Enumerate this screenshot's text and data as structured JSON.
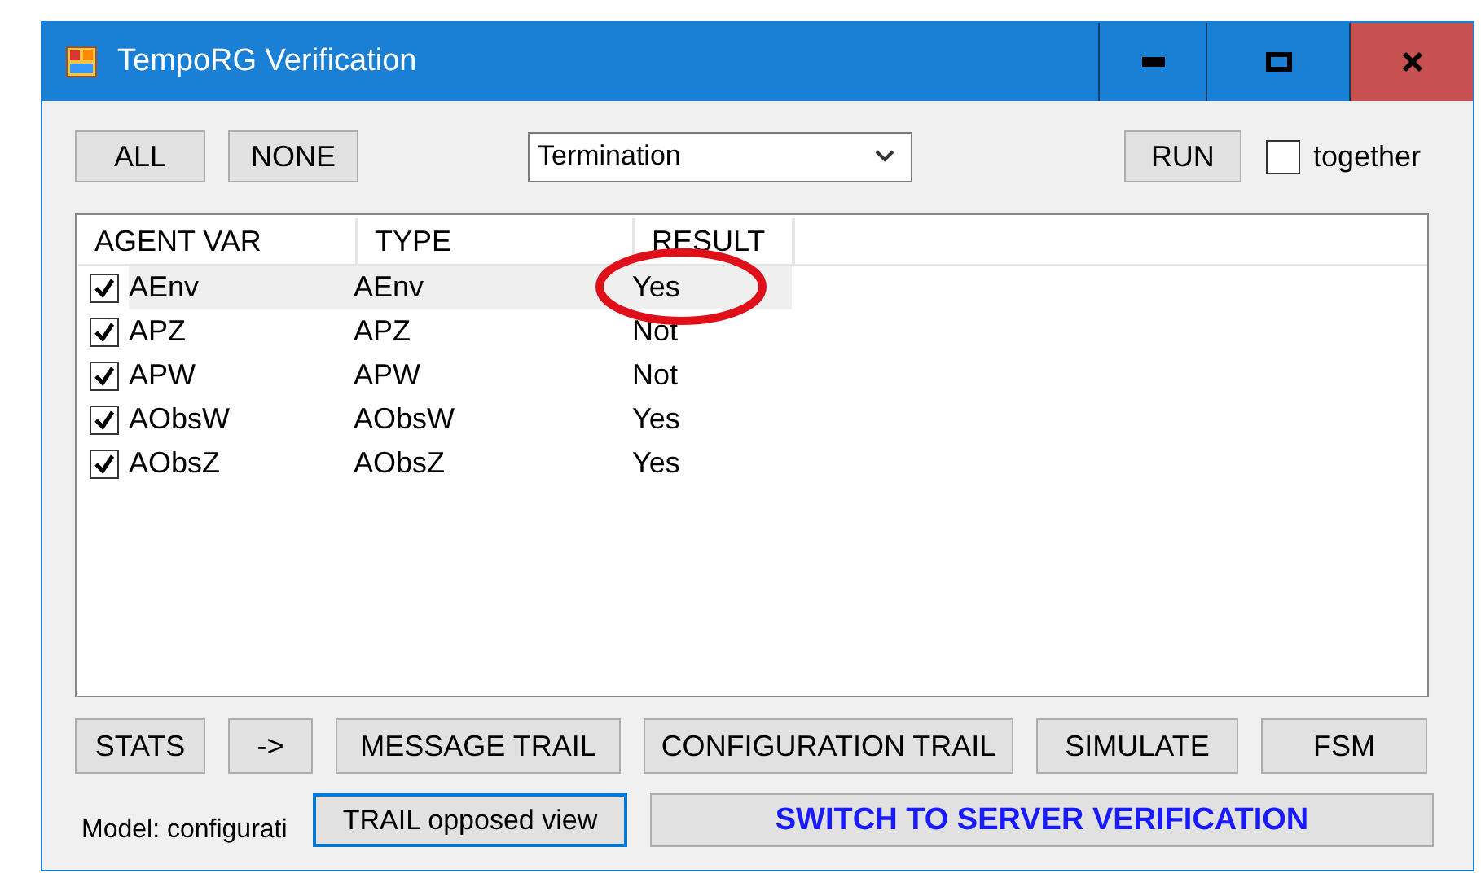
{
  "window": {
    "title": "TempoRG Verification"
  },
  "toolbar": {
    "buttons": [
      "ALL",
      "NONE"
    ],
    "dropdown": {
      "value": "Termination"
    },
    "run_button": "RUN",
    "together": {
      "label": "together",
      "checked": false
    }
  },
  "table": {
    "columns": [
      "AGENT VAR",
      "TYPE",
      "RESULT"
    ],
    "rows": [
      {
        "checked": true,
        "selected": true,
        "circled": true,
        "agent_var": "AEnv",
        "type": "AEnv",
        "result": "Yes"
      },
      {
        "checked": true,
        "selected": false,
        "circled": false,
        "agent_var": "APZ",
        "type": "APZ",
        "result": "Not"
      },
      {
        "checked": true,
        "selected": false,
        "circled": false,
        "agent_var": "APW",
        "type": "APW",
        "result": "Not"
      },
      {
        "checked": true,
        "selected": false,
        "circled": false,
        "agent_var": "AObsW",
        "type": "AObsW",
        "result": "Yes"
      },
      {
        "checked": true,
        "selected": false,
        "circled": false,
        "agent_var": "AObsZ",
        "type": "AObsZ",
        "result": "Yes"
      }
    ]
  },
  "action_buttons": [
    "STATS",
    "->",
    "MESSAGE TRAIL",
    "CONFIGURATION TRAIL",
    "SIMULATE",
    "FSM"
  ],
  "footer": {
    "model_label": "Model: configurati",
    "trail_button": {
      "label": "TRAIL opposed view",
      "focused": true
    },
    "switch_button": "SWITCH TO SERVER VERIFICATION"
  }
}
